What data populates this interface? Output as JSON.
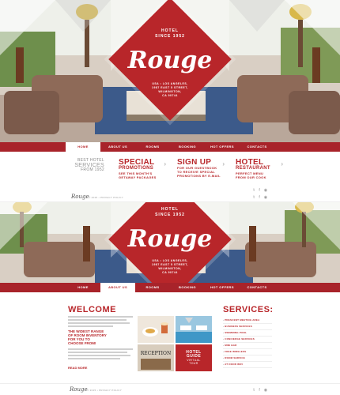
{
  "brand": {
    "hotel_label": "HOTEL",
    "since_label": "SINCE 1952",
    "logo": "Rouge",
    "address_1": "USA • LOS ANGELES,",
    "address_2": "1987 EAST 5 STREET,",
    "address_3": "WILMINGTON,",
    "address_4": "CA 90744"
  },
  "nav": {
    "items": [
      "HOME",
      "ABOUT US",
      "ROOMS",
      "BOOKING",
      "HOT OFFERS",
      "CONTACTS"
    ],
    "active_top": 0,
    "active_bottom": 1
  },
  "promo": {
    "best_1": "BEST HOTEL",
    "best_2": "SERVICES",
    "best_3": "FROM 1952",
    "special_title": "SPECIAL",
    "special_sub_title": "PROMOTIONS",
    "special_1": "SEE THIS MONTH'S",
    "special_2": "GETAWAY PACKAGES",
    "signup_title": "SIGN UP",
    "signup_1": "FOR OUR GUESTBOOK",
    "signup_2": "TO RECEIVE SPECIAL",
    "signup_3": "PROMOTIONS BY E-MAIL",
    "rest_title": "HOTEL",
    "rest_sub_title": "RESTAURANT",
    "rest_1": "PERFECT MENU",
    "rest_2": "FROM OUR COOK"
  },
  "header": {
    "logo": "Rouge",
    "copyright": "© 2015 • PRIVACY POLICY"
  },
  "welcome": {
    "title": "WELCOME",
    "range_1": "THE WIDEST RANGE",
    "range_2": "OF ROOM INVENTORY",
    "range_3": "FOR YOU TO",
    "range_4": "CHOOSE FROM!",
    "read_more": "READ MORE"
  },
  "tiles": {
    "guide_1": "HOTEL",
    "guide_2": "GUIDE",
    "guide_3": "VIRTUAL",
    "guide_4": "TOUR",
    "reception": "RECEPTION"
  },
  "services": {
    "title": "SERVICES:",
    "items": [
      "PRESCENT MEETING AREA",
      "BUSINESS SERVICES",
      "SWIMMING POOL",
      "CONCIERGE SERVICES",
      "MINI BAR",
      "FREE WIRELESS",
      "ROOM SERVICE",
      "AT DOOR WIFI"
    ]
  },
  "footer": {
    "logo": "Rouge",
    "copyright": "© 2015 • PRIVACY POLICY"
  },
  "colors": {
    "brand_red": "#b8262a",
    "nav_red": "#a8232a"
  }
}
